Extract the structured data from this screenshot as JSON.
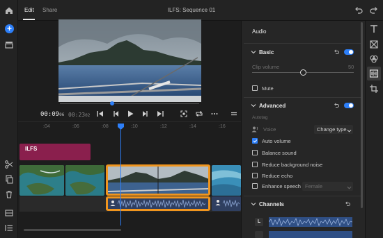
{
  "app": {
    "tabs": [
      {
        "label": "Edit",
        "active": true
      },
      {
        "label": "Share",
        "active": false
      }
    ],
    "sequence_title": "ILFS: Sequence 01"
  },
  "player": {
    "current_time": "00:09",
    "current_frames": "06",
    "total_time": "00:23",
    "total_frames": "02"
  },
  "ruler": {
    "ticks": ":04",
    "labels": [
      ":04",
      ":06",
      ":08",
      ":10",
      ":12",
      ":14",
      ":16"
    ]
  },
  "timeline": {
    "title_clip_label": "ILFS"
  },
  "panel": {
    "title": "Audio",
    "basic": {
      "label": "Basic",
      "clip_volume_label": "Clip volume",
      "clip_volume_value": "50",
      "clip_volume_level": 0.5,
      "mute_label": "Mute",
      "mute_checked": false
    },
    "advanced": {
      "label": "Advanced",
      "autotag_label": "Autotag",
      "voice_label": "Voice",
      "change_type_label": "Change type",
      "options": [
        {
          "label": "Auto volume",
          "checked": true
        },
        {
          "label": "Balance sound",
          "checked": false
        },
        {
          "label": "Reduce background noise",
          "checked": false
        },
        {
          "label": "Reduce echo",
          "checked": false
        },
        {
          "label": "Enhance speech",
          "checked": false
        }
      ],
      "enhance_speech_select": "Female"
    },
    "channels": {
      "label": "Channels",
      "left_label": "L"
    }
  },
  "colors": {
    "accent": "#2d7ff9",
    "selection": "#f0951e",
    "title_clip": "#8a1f4d",
    "audio_clip": "#2f3f60"
  }
}
